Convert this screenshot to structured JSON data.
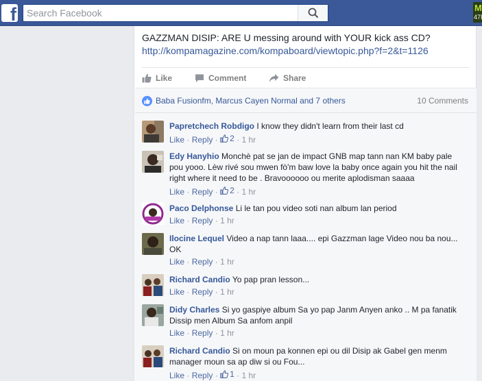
{
  "topbar": {
    "search_placeholder": "Search Facebook",
    "logo_letter": "f",
    "corner_badge_top": "M",
    "corner_badge_bottom": "47I"
  },
  "post": {
    "text": "GAZZMAN DISIP: ARE U messing around with YOUR kick ass CD?",
    "link": "http://kompamagazine.com/kompaboard/viewtopic.php?f=2&t=1126"
  },
  "actions": {
    "like": "Like",
    "comment": "Comment",
    "share": "Share"
  },
  "summary": {
    "names": "Baba Fusionfm, Marcus Cayen Normal and 7 others",
    "count": "10 Comments"
  },
  "meta_labels": {
    "like": "Like",
    "reply": "Reply",
    "sep": "·"
  },
  "comments": [
    {
      "author": "Papretchech Robdigo",
      "text": "I know they didn't learn from their last cd",
      "likes": "2",
      "time": "1 hr"
    },
    {
      "author": "Edy Hanyhio",
      "text": "Monchè pat se jan de impact GNB map tann nan KM baby pale pou yooo. Lèw rivé sou mwen fò'm baw love la baby once again you hit the nail right where it need to be . Bravoooooo ou merite aplodisman saaaa",
      "likes": "2",
      "time": "1 hr"
    },
    {
      "author": "Paco Delphonse",
      "text": "Li le tan pou video soti nan album lan period",
      "likes": "",
      "time": "1 hr"
    },
    {
      "author": "Ilocine Lequel",
      "text": "Video a nap tann laaa.... epi Gazzman lage Video nou ba nou... OK",
      "likes": "",
      "time": "1 hr"
    },
    {
      "author": "Richard Candio",
      "text": "Yo pap pran lesson...",
      "likes": "",
      "time": "1 hr"
    },
    {
      "author": "Didy Charles",
      "text": "Si yo gaspiye album Sa yo pap Janm Anyen anko .. M pa fanatik Dissip men Album Sa anfom anpil",
      "likes": "",
      "time": "1 hr"
    },
    {
      "author": "Richard Candio",
      "text": "Si on moun pa konnen epi ou dil Disip ak Gabel gen menm manager moun sa ap diw si ou Fou...",
      "likes": "1",
      "time": "1 hr"
    }
  ],
  "colors": {
    "brand": "#3b5998",
    "link": "#365899",
    "muted": "#90949c",
    "reaction": "#5890ff"
  }
}
